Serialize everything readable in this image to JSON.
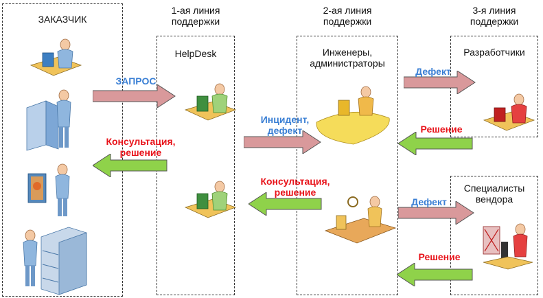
{
  "columns": {
    "customer": "ЗАКАЗЧИК",
    "line1": "1-ая линия\nподдержки",
    "line2": "2-ая линия\nподдержки",
    "line3": "3-я линия\nподдержки"
  },
  "boxes": {
    "helpdesk": "HelpDesk",
    "engineers": "Инженеры,\nадминистраторы",
    "developers": "Разработчики",
    "vendor": "Специалисты\nвендора"
  },
  "arrow_labels": {
    "request": "ЗАПРОС",
    "consult1": "Консультация,\nрешение",
    "incident": "Инцидент,\nдефект",
    "consult2": "Консультация,\nрешение",
    "defect1": "Дефект",
    "solution1": "Решение",
    "defect2": "Дефект",
    "solution2": "Решение"
  },
  "colors": {
    "forward_arrow": "#d9999b",
    "back_arrow": "#8fd24a",
    "red_text": "#e8141b",
    "blue_text": "#3a7fd4"
  }
}
